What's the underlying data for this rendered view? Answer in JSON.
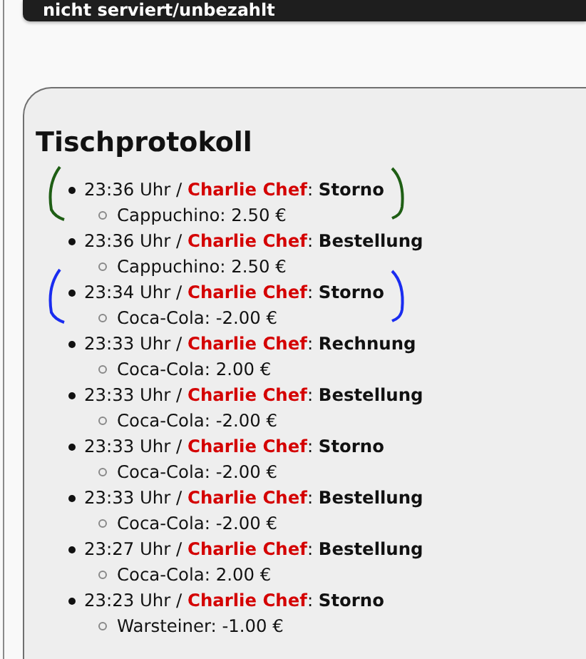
{
  "top_bar": {
    "text": "nicht serviert/unbezahlt"
  },
  "panel": {
    "title": "Tischprotokoll",
    "entries": [
      {
        "text": "23:36 Uhr / **Charlie Chef**: **Storno**",
        "item": "Cappuchino: 2.50 €",
        "color": "#1e5e14"
      },
      {
        "text": "23:36 Uhr / **Charlie Chef**: **Bestellung**",
        "item": "Cappuchino: 2.50 €"
      },
      {
        "text": "23:34 Uhr / **Charlie Chef**: **Storno**",
        "item": "Coca-Cola: -2.00 €",
        "color": "#1a2cf0"
      },
      {
        "text": "23:33 Uhr / **Charlie Chef**: **Rechnung**",
        "item": "Coca-Cola: 2.00 €"
      },
      {
        "text": "23:33 Uhr / **Charlie Chef**: **Bestellung**",
        "item": "Coca-Cola: -2.00 €"
      },
      {
        "text": "23:33 Uhr / **Charlie Chef**: **Storno**",
        "item": "Coca-Cola: -2.00 €"
      },
      {
        "text": "23:33 Uhr / **Charlie Chef**: **Bestellung**",
        "item": "Coca-Cola: -2.00 €"
      },
      {
        "text": "23:27 Uhr / **Charlie Chef**: **Bestellung**",
        "item": "Coca-Cola: 2.00 €"
      },
      {
        "text": "23:23 Uhr / **Charlie Chef**: **Storno**",
        "item": "Warsteiner: -1.00 €"
      }
    ]
  }
}
